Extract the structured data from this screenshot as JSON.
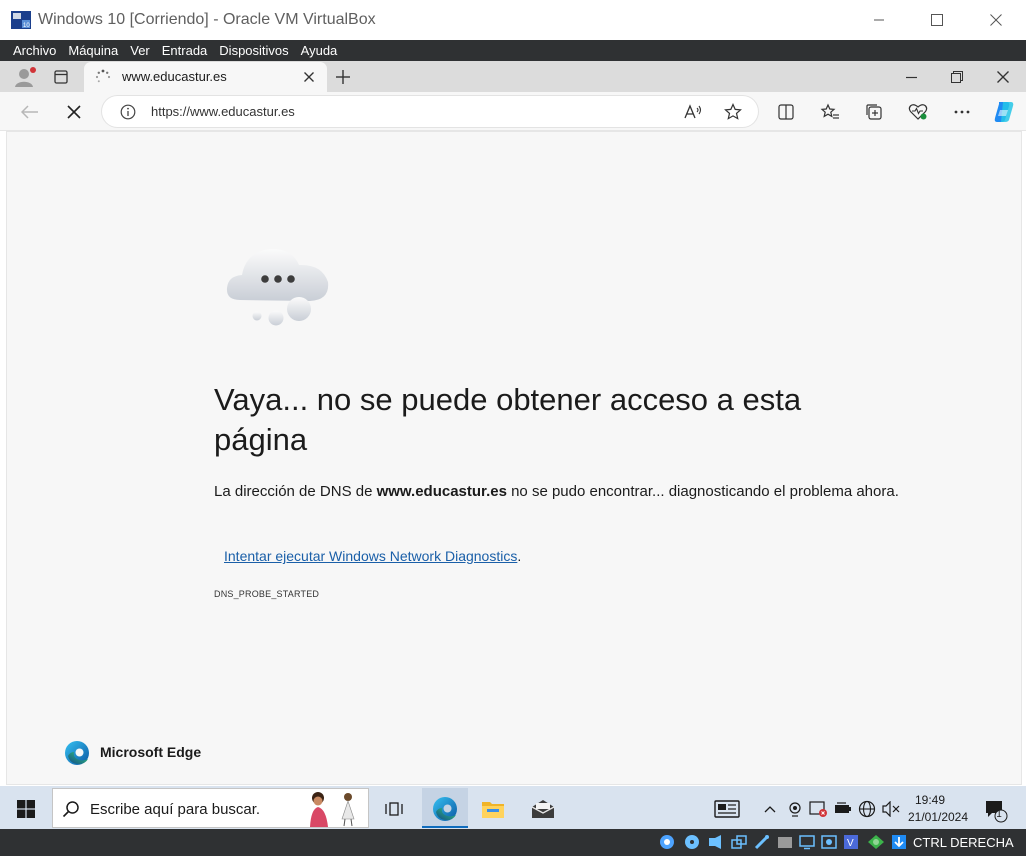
{
  "vbox": {
    "window_title": "Windows 10 [Corriendo] - Oracle VM VirtualBox",
    "menu": [
      "Archivo",
      "Máquina",
      "Ver",
      "Entrada",
      "Dispositivos",
      "Ayuda"
    ],
    "host_key": "CTRL DERECHA"
  },
  "edge": {
    "tab_title": "www.educastur.es",
    "address": "https://www.educastur.es",
    "brand": "Microsoft Edge"
  },
  "error_page": {
    "title": "Vaya... no se puede obtener acceso a esta página",
    "desc_prefix": "La dirección de DNS de ",
    "desc_domain": "www.educastur.es",
    "desc_suffix": " no se pudo encontrar... diagnosticando el problema ahora.",
    "link": "Intentar ejecutar Windows Network Diagnostics",
    "link_suffix": ".",
    "error_code": "DNS_PROBE_STARTED"
  },
  "taskbar": {
    "search_placeholder": "Escribe aquí para buscar.",
    "time": "19:49",
    "date": "21/01/2024",
    "notification_count": "1"
  },
  "colors": {
    "vbox_bar": "#2f3133",
    "edge_tabstrip": "#dcdcdc",
    "page_bg": "#f7f7f7",
    "link": "#1a5fa8",
    "taskbar": "#d9e3ef",
    "copilot_accent": "#1f8bf3"
  }
}
